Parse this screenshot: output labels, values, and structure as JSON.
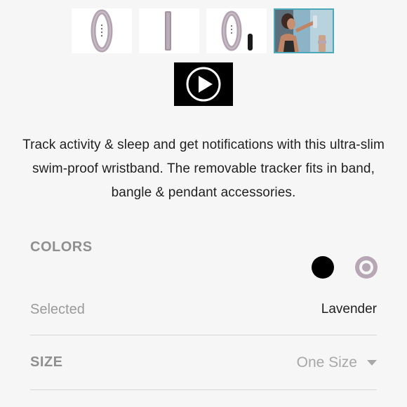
{
  "gallery": {
    "thumbnails": [
      {
        "name": "band-front-thumbnail"
      },
      {
        "name": "band-side-thumbnail"
      },
      {
        "name": "band-with-tracker-thumbnail"
      },
      {
        "name": "lifestyle-photo-thumbnail",
        "selected": true
      }
    ],
    "video_icon": "play-icon"
  },
  "description": "Track activity & sleep and get notifications with this ultra-slim swim-proof wristband. The removable tracker fits in band, bangle & pendant accessories.",
  "colors": {
    "heading": "COLORS",
    "options": [
      {
        "name": "Black",
        "hex": "#000000"
      },
      {
        "name": "Lavender",
        "hex": "#b7a7b4"
      }
    ],
    "selected_label": "Selected",
    "selected_value": "Lavender"
  },
  "size": {
    "heading": "SIZE",
    "value": "One Size",
    "icon": "chevron-down-icon"
  },
  "colors_theme": {
    "background": "#f6f6f6",
    "heading_gray": "#8f8f8f",
    "active_border": "#4aa8b8"
  }
}
